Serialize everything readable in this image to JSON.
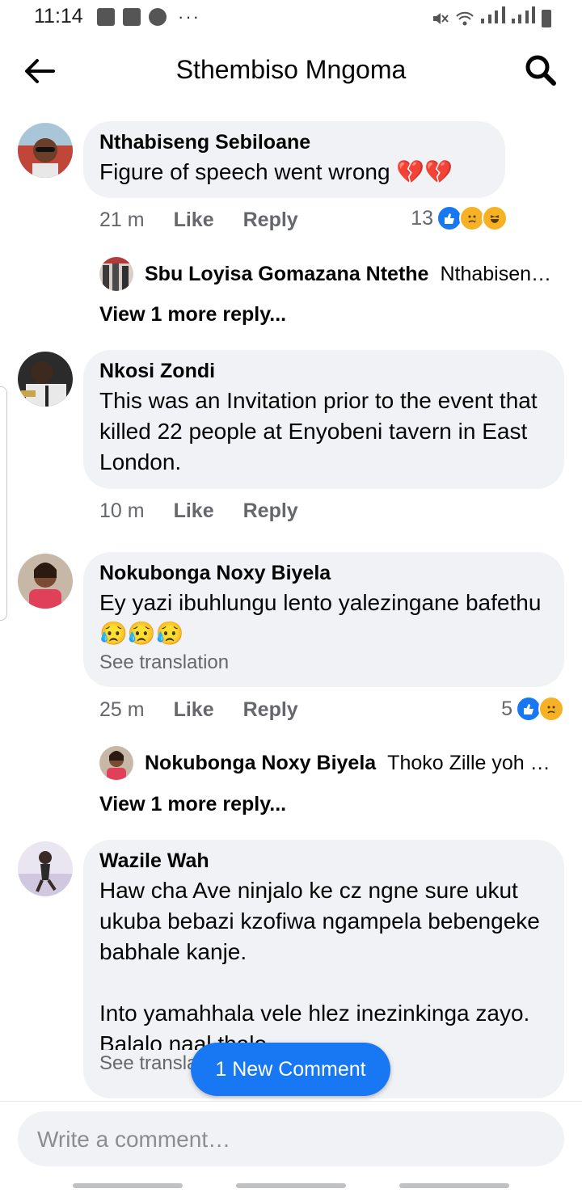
{
  "status_bar": {
    "time": "11:14",
    "overflow": "···"
  },
  "header": {
    "title": "Sthembiso Mngoma"
  },
  "comments": [
    {
      "author": "Nthabiseng Sebiloane",
      "text": "Figure of speech went wrong 💔💔",
      "time": "21 m",
      "like": "Like",
      "reply": "Reply",
      "reaction_count": "13",
      "reactions": [
        "like",
        "sad",
        "haha"
      ],
      "reply_preview": {
        "author": "Sbu Loyisa Gomazana Ntethe",
        "snippet": "Nthabiseng…"
      },
      "view_more": "View 1 more reply..."
    },
    {
      "author": "Nkosi Zondi",
      "text": "This was an Invitation prior to the event that killed 22 people at Enyobeni tavern in East London.",
      "time": "10 m",
      "like": "Like",
      "reply": "Reply"
    },
    {
      "author": "Nokubonga Noxy Biyela",
      "text": "Ey yazi ibuhlungu lento yalezingane bafethu😥😥😥",
      "see_translation": "See translation",
      "time": "25 m",
      "like": "Like",
      "reply": "Reply",
      "reaction_count": "5",
      "reactions": [
        "like",
        "sad"
      ],
      "reply_preview": {
        "author": "Nokubonga Noxy Biyela",
        "snippet": "Thoko Zille yoh gir…"
      },
      "view_more": "View 1 more reply..."
    },
    {
      "author": "Wazile Wah",
      "text": "Haw cha Ave ninjalo ke cz ngne sure ukut ukuba bebazi kzofiwa ngampela bebengeke babhale kanje.\n\nInto yamahhala vele hlez inezinkinga zayo. Balalo naal thalo",
      "see_translation": "See translation"
    }
  ],
  "new_comment_label": "1 New Comment",
  "composer": {
    "placeholder": "Write a comment…"
  },
  "colors": {
    "accent": "#1877f2",
    "bubble": "#f0f2f5",
    "muted": "#65676b"
  }
}
